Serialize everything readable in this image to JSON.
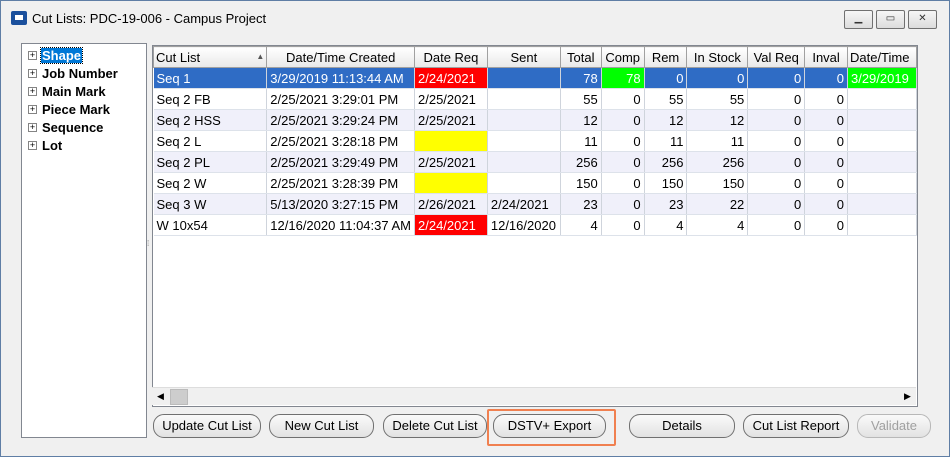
{
  "window": {
    "title": "Cut Lists: PDC-19-006 - Campus Project",
    "controls": {
      "minimize": "▁",
      "maximize": "▭",
      "close": "✕"
    }
  },
  "tree": {
    "items": [
      {
        "label": "Shape",
        "selected": true
      },
      {
        "label": "Job Number"
      },
      {
        "label": "Main Mark"
      },
      {
        "label": "Piece Mark"
      },
      {
        "label": "Sequence"
      },
      {
        "label": "Lot"
      }
    ],
    "expander_glyph": "+"
  },
  "grid": {
    "columns": [
      "Cut List",
      "Date/Time Created",
      "Date Req",
      "Sent",
      "Total",
      "Comp",
      "Rem",
      "In Stock",
      "Val Req",
      "Inval",
      "Date/Time"
    ],
    "sort_indicator": "▲",
    "rows": [
      [
        "Seq 1",
        "3/29/2019 11:13:44 AM",
        "2/24/2021",
        "",
        "78",
        "78",
        "0",
        "0",
        "0",
        "0",
        "3/29/2019"
      ],
      [
        "Seq 2 FB",
        "2/25/2021 3:29:01 PM",
        "2/25/2021",
        "",
        "55",
        "0",
        "55",
        "55",
        "0",
        "0",
        ""
      ],
      [
        "Seq 2 HSS",
        "2/25/2021 3:29:24 PM",
        "2/25/2021",
        "",
        "12",
        "0",
        "12",
        "12",
        "0",
        "0",
        ""
      ],
      [
        "Seq 2 L",
        "2/25/2021 3:28:18 PM",
        "",
        "",
        "11",
        "0",
        "11",
        "11",
        "0",
        "0",
        ""
      ],
      [
        "Seq 2 PL",
        "2/25/2021 3:29:49 PM",
        "2/25/2021",
        "",
        "256",
        "0",
        "256",
        "256",
        "0",
        "0",
        ""
      ],
      [
        "Seq 2 W",
        "2/25/2021 3:28:39 PM",
        "",
        "",
        "150",
        "0",
        "150",
        "150",
        "0",
        "0",
        ""
      ],
      [
        "Seq 3 W",
        "5/13/2020 3:27:15 PM",
        "2/26/2021",
        "2/24/2021",
        "23",
        "0",
        "23",
        "22",
        "0",
        "0",
        ""
      ],
      [
        "W 10x54",
        "12/16/2020 11:04:37 AM",
        "2/24/2021",
        "12/16/2020",
        "4",
        "0",
        "4",
        "4",
        "0",
        "0",
        ""
      ]
    ],
    "colors": {
      "red": "#ff0000",
      "yellow": "#ffff00",
      "green": "#00ff00",
      "selected": "#2f6cc5"
    }
  },
  "scrollbar": {
    "left": "◀",
    "right": "▶"
  },
  "buttons": {
    "update": "Update Cut List",
    "new": "New Cut List",
    "delete": "Delete Cut List",
    "export": "DSTV+ Export",
    "details": "Details",
    "report": "Cut List Report",
    "validate": "Validate"
  }
}
